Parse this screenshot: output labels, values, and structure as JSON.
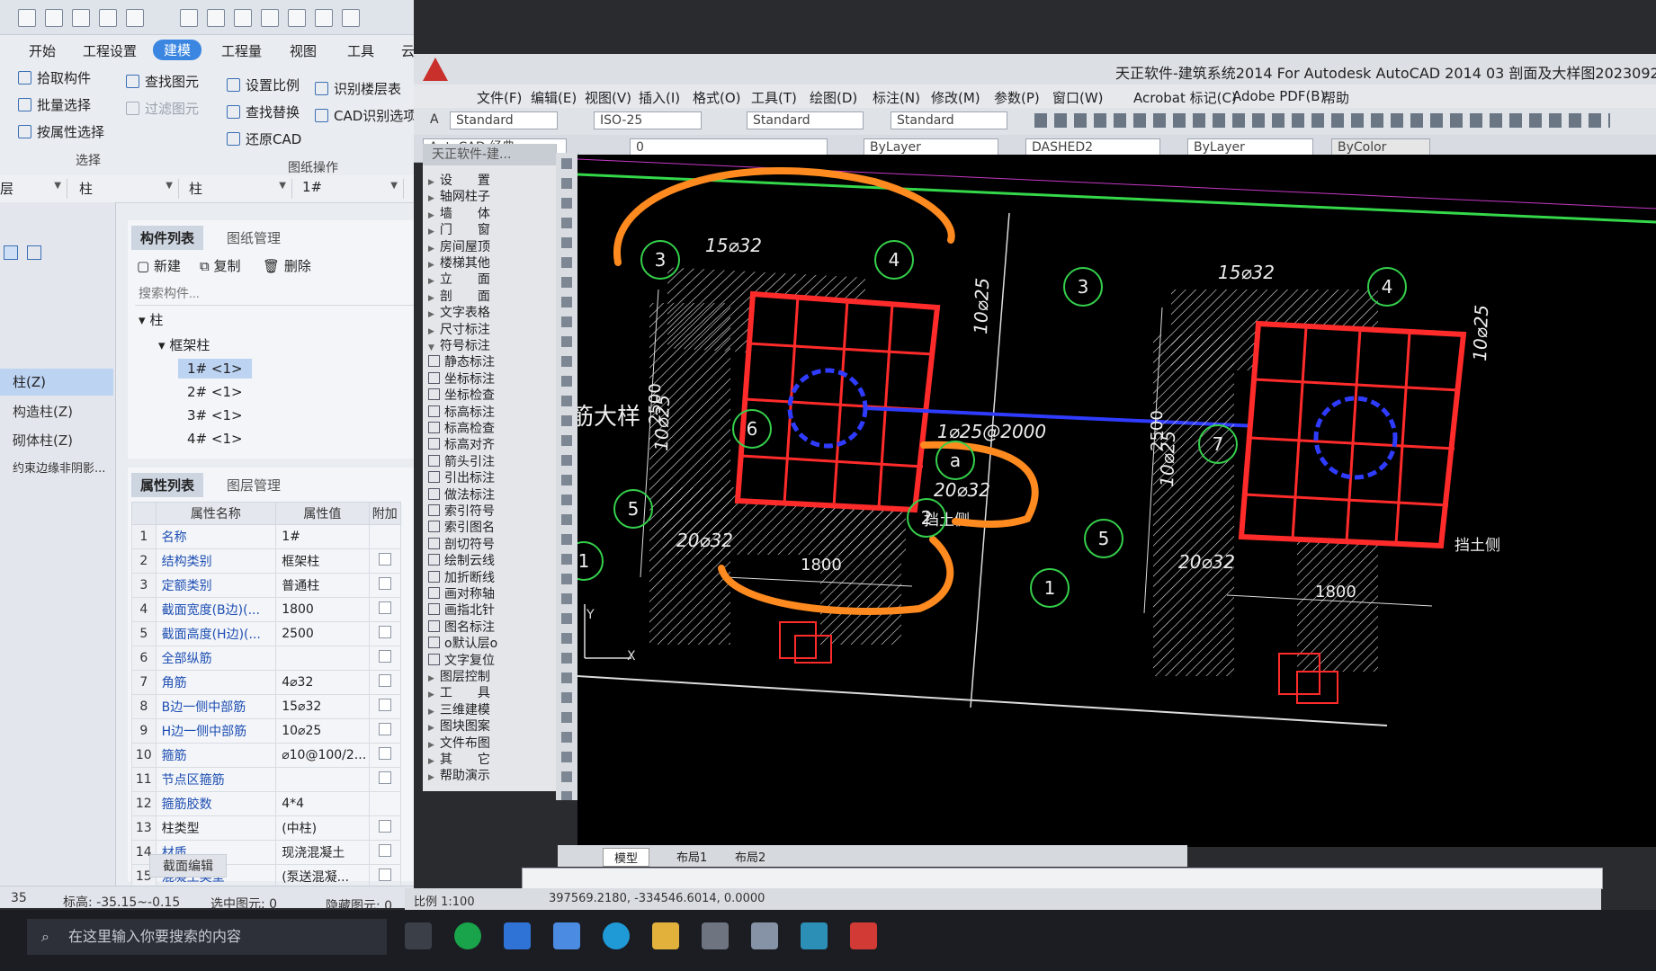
{
  "left_app": {
    "menu_tabs": [
      "开始",
      "工程设置",
      "建模",
      "工程量",
      "视图",
      "工具",
      "云"
    ],
    "active_tab": "建模",
    "ribbon": {
      "pick_component": "拾取构件",
      "find_element": "查找图元",
      "set_scale": "设置比例",
      "identify_floor_table": "识别楼层表",
      "batch_select": "批量选择",
      "filter_element": "过滤图元",
      "find_replace": "查找替换",
      "cad_identify_options": "CAD识别选项",
      "select_by_attr": "按属性选择",
      "restore_cad": "还原CAD",
      "group_select": "选择",
      "group_drawing_ops": "图纸操作"
    },
    "filter_row": {
      "floor": "层",
      "type1": "柱",
      "type2": "柱",
      "name": "1#"
    },
    "left_strip": [
      "柱(Z)",
      "构造柱(Z)",
      "砌体柱(Z)",
      "约束边缘非阴影..."
    ],
    "component_panel": {
      "tabs": [
        "构件列表",
        "图纸管理"
      ],
      "new": "新建",
      "copy": "复制",
      "delete": "删除",
      "search_placeholder": "搜索构件...",
      "tree_root": "柱",
      "tree_group": "框架柱",
      "tree_items": [
        "1# <1>",
        "2# <1>",
        "3# <1>",
        "4# <1>"
      ]
    },
    "property_panel": {
      "tabs": [
        "属性列表",
        "图层管理"
      ],
      "headers": [
        "属性名称",
        "属性值",
        "附加"
      ],
      "rows": [
        {
          "n": "1",
          "name": "名称",
          "value": "1#",
          "cb": false
        },
        {
          "n": "2",
          "name": "结构类别",
          "value": "框架柱",
          "cb": true
        },
        {
          "n": "3",
          "name": "定额类别",
          "value": "普通柱",
          "cb": true
        },
        {
          "n": "4",
          "name": "截面宽度(B边)(...",
          "value": "1800",
          "cb": true
        },
        {
          "n": "5",
          "name": "截面高度(H边)(...",
          "value": "2500",
          "cb": true
        },
        {
          "n": "6",
          "name": "全部纵筋",
          "value": "",
          "cb": true
        },
        {
          "n": "7",
          "name": "角筋",
          "value": "4⌀32",
          "cb": true
        },
        {
          "n": "8",
          "name": "B边一侧中部筋",
          "value": "15⌀32",
          "cb": true
        },
        {
          "n": "9",
          "name": "H边一侧中部筋",
          "value": "10⌀25",
          "cb": true
        },
        {
          "n": "10",
          "name": "箍筋",
          "value": "⌀10@100/2...",
          "cb": true
        },
        {
          "n": "11",
          "name": "节点区箍筋",
          "value": "",
          "cb": true
        },
        {
          "n": "12",
          "name": "箍筋胶数",
          "value": "4*4",
          "cb": false
        },
        {
          "n": "13",
          "name": "柱类型",
          "value": "(中柱)",
          "cb": true
        },
        {
          "n": "14",
          "name": "材质",
          "value": "现浇混凝土",
          "cb": true
        },
        {
          "n": "15",
          "name": "混凝土类型",
          "value": "(泵送混凝...",
          "cb": true
        }
      ],
      "section_edit": "截面编辑"
    },
    "status": {
      "num": "35",
      "elevation": "标高: -35.15~-0.15",
      "selected": "选中图元: 0",
      "hidden": "隐藏图元: 0"
    }
  },
  "cad": {
    "title": "天正软件-建筑系统2014 For Autodesk AutoCAD 2014    03 剖面及大样图2023092",
    "menus": [
      "文件(F)",
      "编辑(E)",
      "视图(V)",
      "插入(I)",
      "格式(O)",
      "工具(T)",
      "绘图(D)",
      "标注(N)",
      "修改(M)",
      "参数(P)",
      "窗口(W)",
      "Acrobat 标记(C)",
      "Adobe PDF(B)",
      "帮助"
    ],
    "tb1": {
      "text_style": "Standard",
      "dim_style": "ISO-25",
      "table_style": "Standard",
      "ml_style": "Standard"
    },
    "tb2": {
      "workspace": "AutoCAD 经典",
      "layer": "0",
      "color": "ByLayer",
      "linetype": "DASHED2",
      "lineweight": "ByLayer",
      "plotstyle": "ByColor"
    },
    "palette": {
      "title": "天正软件-建...",
      "items": [
        {
          "t": "设　　置",
          "k": "tri"
        },
        {
          "t": "轴网柱子",
          "k": "tri"
        },
        {
          "t": "墙　　体",
          "k": "tri"
        },
        {
          "t": "门　　窗",
          "k": "tri"
        },
        {
          "t": "房间屋顶",
          "k": "tri"
        },
        {
          "t": "楼梯其他",
          "k": "tri"
        },
        {
          "t": "立　　面",
          "k": "tri"
        },
        {
          "t": "剖　　面",
          "k": "tri"
        },
        {
          "t": "文字表格",
          "k": "tri"
        },
        {
          "t": "尺寸标注",
          "k": "tri"
        },
        {
          "t": "符号标注",
          "k": "open"
        },
        {
          "t": "静态标注",
          "k": "ic"
        },
        {
          "t": "坐标标注",
          "k": "ic"
        },
        {
          "t": "坐标检查",
          "k": "ic"
        },
        {
          "t": "标高标注",
          "k": "ic"
        },
        {
          "t": "标高检查",
          "k": "ic"
        },
        {
          "t": "标高对齐",
          "k": "ic"
        },
        {
          "t": "箭头引注",
          "k": "ic"
        },
        {
          "t": "引出标注",
          "k": "ic"
        },
        {
          "t": "做法标注",
          "k": "ic"
        },
        {
          "t": "索引符号",
          "k": "ic"
        },
        {
          "t": "索引图名",
          "k": "ic"
        },
        {
          "t": "剖切符号",
          "k": "ic"
        },
        {
          "t": "绘制云线",
          "k": "ic"
        },
        {
          "t": "加折断线",
          "k": "ic"
        },
        {
          "t": "画对称轴",
          "k": "ic"
        },
        {
          "t": "画指北针",
          "k": "ic"
        },
        {
          "t": "图名标注",
          "k": "ic"
        },
        {
          "t": "o默认层o",
          "k": "ic"
        },
        {
          "t": "文字复位",
          "k": "ic"
        },
        {
          "t": "图层控制",
          "k": "tri"
        },
        {
          "t": "工　　具",
          "k": "tri"
        },
        {
          "t": "三维建模",
          "k": "tri"
        },
        {
          "t": "图块图案",
          "k": "tri"
        },
        {
          "t": "文件布图",
          "k": "tri"
        },
        {
          "t": "其　　它",
          "k": "tri"
        },
        {
          "t": "帮助演示",
          "k": "tri"
        }
      ]
    },
    "drawing": {
      "side_label": "筋大样",
      "left": {
        "top_bars": "15⌀32",
        "side_bars": "10⌀25",
        "side_bars_left": "10⌀25",
        "bottom_bars": "20⌀32",
        "width": "1800",
        "height": "2500",
        "tie": "1⌀25@2000",
        "tie_b": "20⌀32",
        "soil_side": "挡土侧",
        "circles": [
          "3",
          "4",
          "6",
          "5",
          "1",
          "a",
          "2"
        ]
      },
      "right": {
        "top_bars": "15⌀32",
        "side_bars": "10⌀25",
        "side_bars_left": "10⌀25",
        "bottom_bars": "20⌀32",
        "width": "1800",
        "height": "2500",
        "soil_side": "挡土侧",
        "circles": [
          "3",
          "4",
          "7",
          "5",
          "1"
        ]
      },
      "ucs_y": "Y",
      "ucs_x": "X"
    },
    "tabs": [
      "模型",
      "布局1",
      "布局2"
    ],
    "status": {
      "scale": "比例 1:100",
      "coords": "397569.2180, -334546.6014, 0.0000"
    }
  },
  "taskbar": {
    "search_placeholder": "在这里输入你要搜索的内容"
  }
}
